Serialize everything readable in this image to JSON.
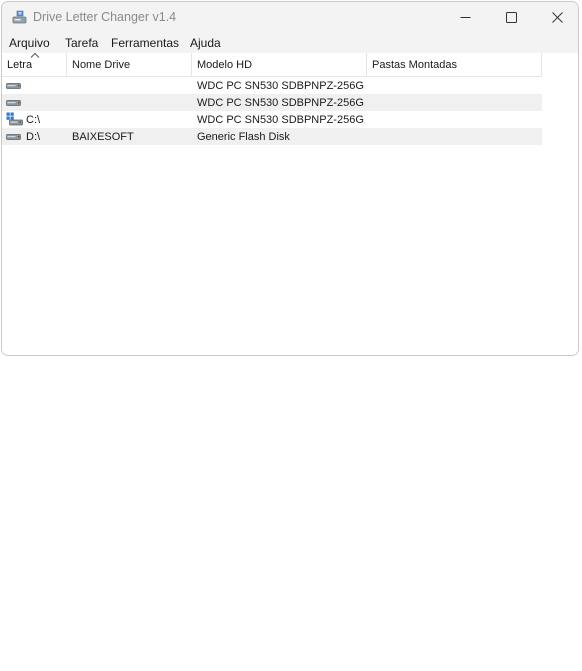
{
  "window": {
    "title": "Drive Letter Changer v1.4"
  },
  "menu": {
    "items": [
      "Arquivo",
      "Tarefa",
      "Ferramentas",
      "Ajuda"
    ]
  },
  "table": {
    "columns": [
      "Letra",
      "Nome Drive",
      "Modelo HD",
      "Pastas Montadas"
    ],
    "sort_column": "Letra",
    "rows": [
      {
        "icon": "drive-icon",
        "letter": "",
        "name": "",
        "model": "WDC PC SN530 SDBPNPZ-256G...",
        "folders": ""
      },
      {
        "icon": "drive-icon",
        "letter": "",
        "name": "",
        "model": "WDC PC SN530 SDBPNPZ-256G...",
        "folders": ""
      },
      {
        "icon": "windows-drive-icon",
        "letter": "C:\\",
        "name": "",
        "model": "WDC PC SN530 SDBPNPZ-256G...",
        "folders": ""
      },
      {
        "icon": "drive-icon",
        "letter": "D:\\",
        "name": "BAIXESOFT",
        "model": "Generic Flash Disk",
        "folders": ""
      }
    ]
  },
  "colors": {
    "titlebar_bg": "#f3f3f3",
    "alt_row_bg": "#f0f0f0",
    "border": "#c9c9c9"
  }
}
